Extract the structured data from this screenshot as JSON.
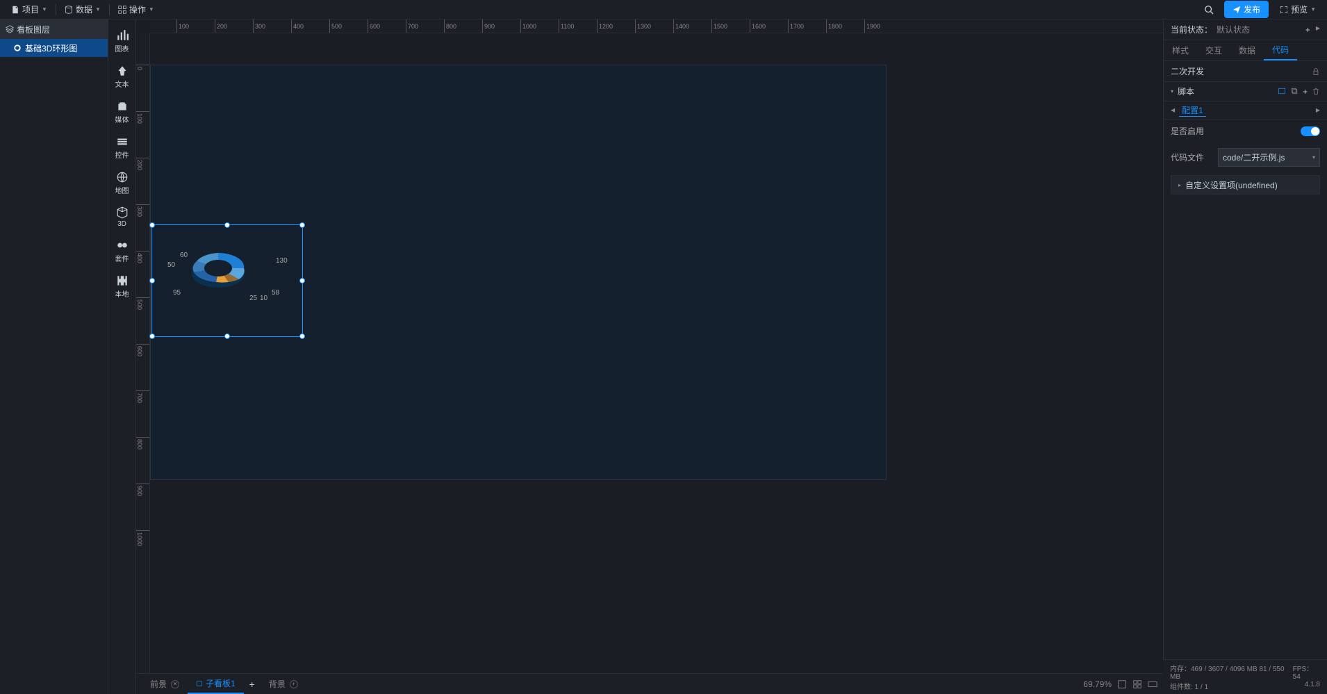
{
  "topMenu": {
    "project": "项目",
    "data": "数据",
    "action": "操作"
  },
  "topRight": {
    "publish": "发布",
    "preview": "预览"
  },
  "layerPanel": {
    "title": "看板图层",
    "item1": "基础3D环形图"
  },
  "compToolbar": {
    "chart": "图表",
    "text": "文本",
    "media": "媒体",
    "control": "控件",
    "map": "地图",
    "3d": "3D",
    "suite": "套件",
    "local": "本地"
  },
  "rulerH": [
    "100",
    "200",
    "300",
    "400",
    "500",
    "600",
    "700",
    "800",
    "900",
    "1000",
    "1100",
    "1200",
    "1300",
    "1400",
    "1500",
    "1600",
    "1700",
    "1800",
    "1900"
  ],
  "rulerV": [
    "0",
    "100",
    "200",
    "300",
    "400",
    "500",
    "600",
    "700",
    "800",
    "900",
    "1000"
  ],
  "donutLabels": {
    "l1": "60",
    "l2": "50",
    "l3": "95",
    "l4": "25",
    "l5": "10",
    "l6": "58",
    "l7": "130"
  },
  "bottomTabs": {
    "foreground": "前景",
    "subboard": "子看板1",
    "background": "背景",
    "zoom": "69.79%"
  },
  "propPanel": {
    "statusLabel": "当前状态：",
    "statusValue": "默认状态",
    "tabs": {
      "style": "样式",
      "interact": "交互",
      "data": "数据",
      "code": "代码"
    },
    "devTitle": "二次开发",
    "scriptSection": "脚本",
    "scriptTab": "配置1",
    "enableLabel": "是否启用",
    "codeFileLabel": "代码文件",
    "codeFileValue": "code/二开示例.js",
    "customSettings": "自定义设置项(undefined)"
  },
  "statusBar": {
    "memory": "内存：469 / 3607 / 4096 MB  81 / 550 MB",
    "fps": "FPS：54",
    "compCount": "组件数: 1 / 1",
    "version": "4.1.8"
  },
  "chart_data": {
    "type": "pie",
    "title": "基础3D环形图",
    "values": [
      130,
      58,
      10,
      25,
      95,
      50,
      60
    ],
    "colors": [
      "#1e7fd4",
      "#5aa7dd",
      "#9a6b2e",
      "#e8a23c",
      "#2563a8",
      "#3a7cb8",
      "#4b93cc"
    ]
  }
}
